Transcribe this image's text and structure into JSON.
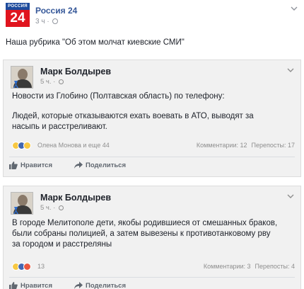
{
  "post": {
    "logo_top": "РОССИЯ",
    "logo_number": "24",
    "page_name": "Россия 24",
    "time": "3 ч · ",
    "text": "Наша рубрика \"Об этом молчат киевские СМИ\""
  },
  "embeds": [
    {
      "author": "Марк Болдырев",
      "time": "5 ч. · ",
      "paragraphs": [
        "Новости из Глобино (Полтавская область) по телефону:",
        "Людей, которые отказываются ехать воевать в АТО, выводят за",
        "насыпь и расстреливают."
      ],
      "reactions_label": "Олена Монова и еще 44",
      "comments": "Комментарии: 12",
      "shares": "Перепосты: 17",
      "like_label": "Нравится",
      "share_label": "Поделиться"
    },
    {
      "author": "Марк Болдырев",
      "time": "5 ч. · ",
      "paragraphs": [
        "В городе Мелитополе дети, якобы родившиеся от смешанных браков,",
        "были собраны полицией, а затем вывезены к противотанковому рву",
        "за городом и расстреляны"
      ],
      "reactions_label": "13",
      "comments": "Комментарии: 3",
      "shares": "Перепосты: 4",
      "like_label": "Нравится",
      "share_label": "Поделиться"
    }
  ],
  "icons": {
    "chevron": "chevron-down-icon",
    "globe": "globe-icon",
    "like": "thumbs-up-icon",
    "share": "share-arrow-icon"
  },
  "colors": {
    "link": "#365899",
    "logo_red": "#e0141e",
    "logo_blue": "#1c4a9c",
    "like_blue": "#4267b2",
    "haha_yellow": "#f7c843",
    "angry_red": "#e9573f"
  }
}
